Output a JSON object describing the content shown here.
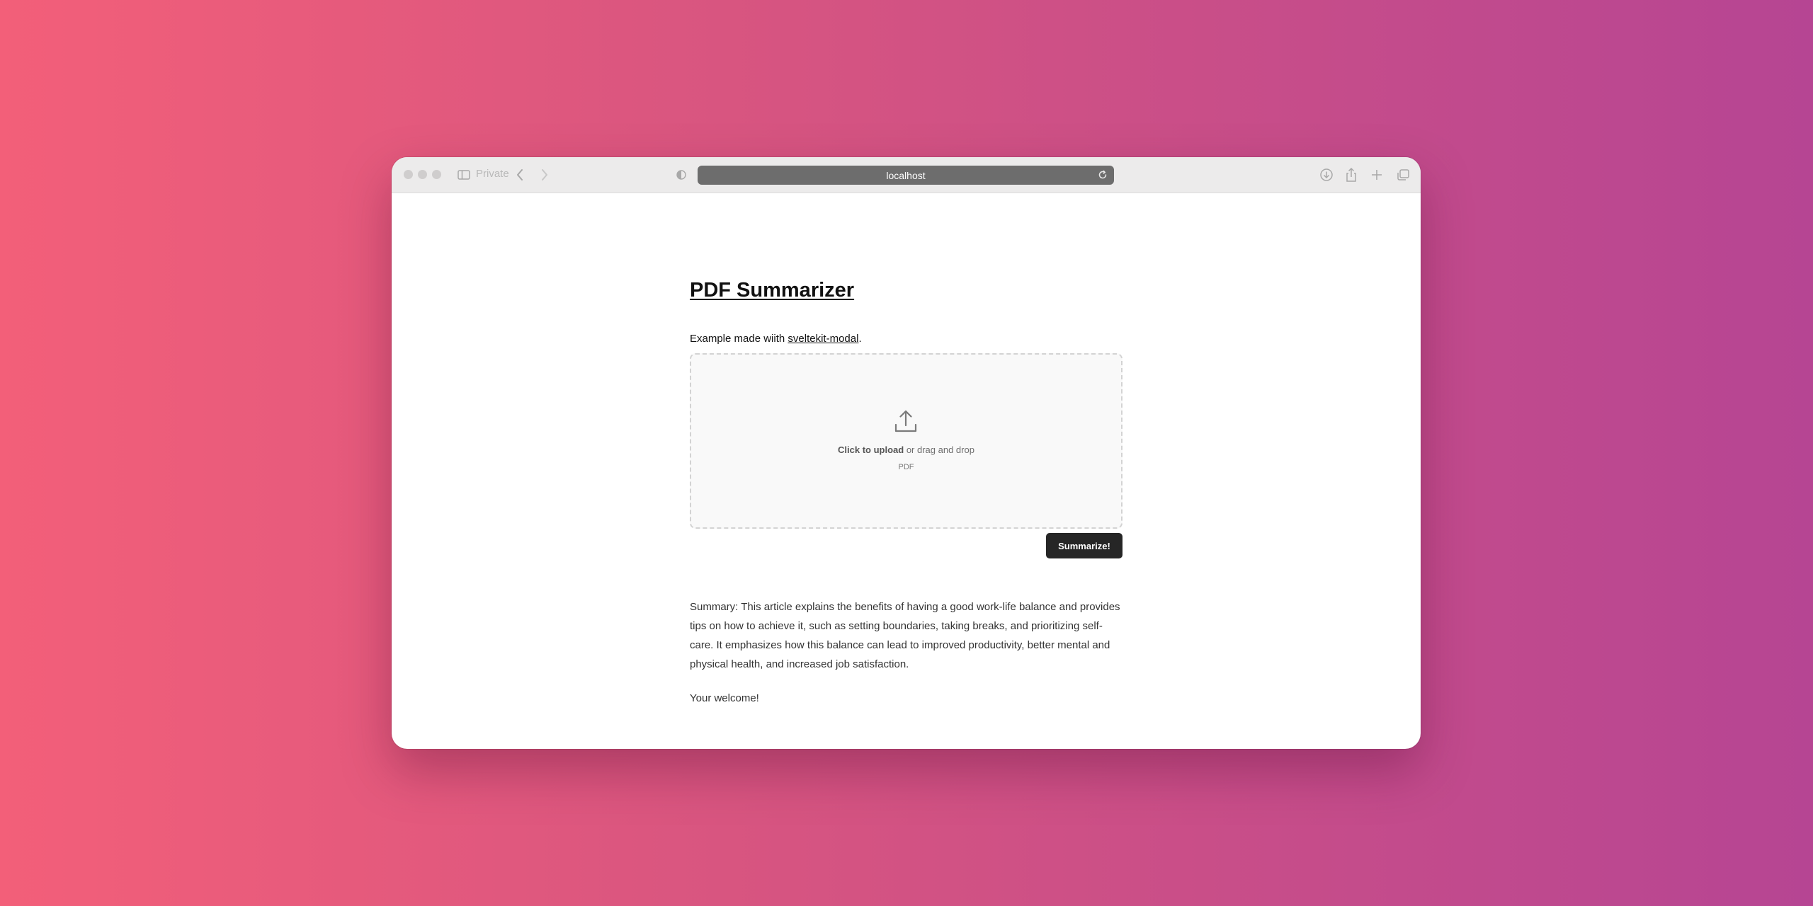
{
  "browser": {
    "private_label": "Private",
    "url": "localhost",
    "icons": [
      "sidebar-icon",
      "back-icon",
      "forward-icon",
      "shield-icon",
      "reload-icon",
      "download-icon",
      "share-icon",
      "new-tab-icon",
      "tabs-overview-icon"
    ]
  },
  "page": {
    "title": "PDF Summarizer",
    "subtitle_prefix": "Example made wiith ",
    "subtitle_link": "sveltekit-modal",
    "subtitle_suffix": ".",
    "upload": {
      "action_bold": "Click to upload",
      "action_rest": " or drag and drop",
      "file_hint": "PDF"
    },
    "submit_label": "Summarize!",
    "summary": "Summary: This article explains the benefits of having a good work-life balance and provides tips on how to achieve it, such as setting boundaries, taking breaks, and prioritizing self-care. It emphasizes how this balance can lead to improved productivity, better mental and physical health, and increased job satisfaction.",
    "closing": "Your welcome!"
  }
}
